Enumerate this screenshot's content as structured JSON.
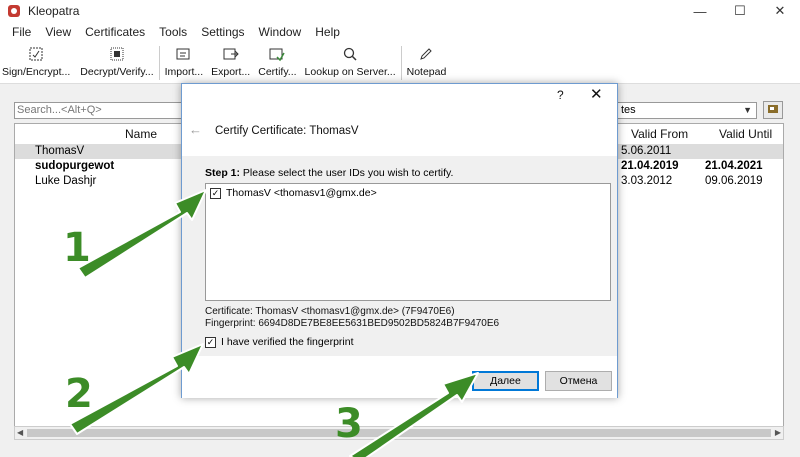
{
  "window": {
    "title": "Kleopatra",
    "controls": [
      "—",
      "☐",
      "✕"
    ]
  },
  "menu": [
    "File",
    "View",
    "Certificates",
    "Tools",
    "Settings",
    "Window",
    "Help"
  ],
  "toolbar": {
    "buttons": [
      {
        "label": "Sign/Encrypt...",
        "icon": "sign-encrypt-icon"
      },
      {
        "label": "Decrypt/Verify...",
        "icon": "decrypt-verify-icon"
      },
      {
        "label": "Import...",
        "icon": "import-icon"
      },
      {
        "label": "Export...",
        "icon": "export-icon"
      },
      {
        "label": "Certify...",
        "icon": "certify-icon"
      },
      {
        "label": "Lookup on Server...",
        "icon": "search-icon"
      },
      {
        "label": "Notepad",
        "icon": "pencil-icon"
      }
    ]
  },
  "search": {
    "placeholder": "Search...<Alt+Q>"
  },
  "filter": {
    "value": "tes"
  },
  "table": {
    "columns": [
      "Name",
      "Valid From",
      "Valid Until"
    ],
    "rows": [
      {
        "name": "ThomasV",
        "valid_from": "5.06.2011",
        "valid_until": "",
        "selected": true,
        "bold": false
      },
      {
        "name": "sudopurgewot",
        "valid_from": "21.04.2019",
        "valid_until": "21.04.2021",
        "selected": false,
        "bold": true
      },
      {
        "name": "Luke Dashjr",
        "valid_from": "3.03.2012",
        "valid_until": "09.06.2019",
        "selected": false,
        "bold": false
      }
    ]
  },
  "dialog": {
    "help": "?",
    "close": "✕",
    "back": "←",
    "title": "Certify Certificate: ThomasV",
    "step_label": "Step 1:",
    "step_text": " Please select the user IDs you wish to certify.",
    "user_ids": [
      {
        "text": "ThomasV <thomasv1@gmx.de>",
        "checked": true
      }
    ],
    "certificate_line": "Certificate: ThomasV <thomasv1@gmx.de> (7F9470E6)",
    "fingerprint_line": "Fingerprint: 6694D8DE7BE8EE5631BED9502BD5824B7F9470E6",
    "verify_label": "I have verified the fingerprint",
    "verify_checked": true,
    "next_button": "Далее",
    "cancel_button": "Отмена"
  },
  "annotations": {
    "labels": [
      "1",
      "2",
      "3"
    ],
    "color": "#3c8c27"
  }
}
